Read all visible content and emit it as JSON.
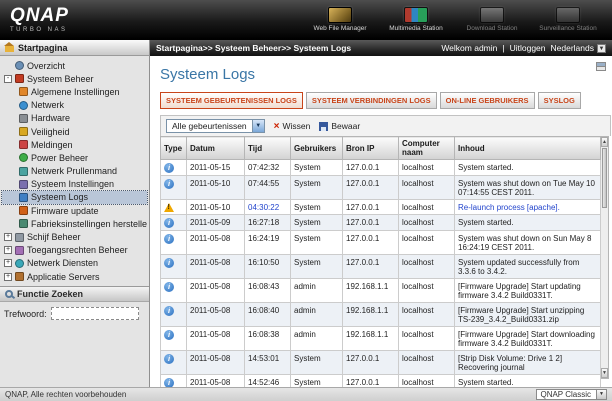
{
  "colors": {
    "accent_orange": "#c8451a",
    "title_blue": "#3a76a6",
    "link_blue": "#2244cc",
    "info_blue": "#2a6fc0",
    "warning_yellow": "#f0a800"
  },
  "header": {
    "logo_main": "QNAP",
    "logo_sub": "TURBO NAS",
    "apps": [
      {
        "label": "Web File Manager",
        "icon": "web-file-manager-icon",
        "dimmed": false
      },
      {
        "label": "Multimedia Station",
        "icon": "multimedia-station-icon",
        "dimmed": false
      },
      {
        "label": "Download Station",
        "icon": "download-station-icon",
        "dimmed": true
      },
      {
        "label": "Surveillance Station",
        "icon": "surveillance-station-icon",
        "dimmed": true
      }
    ]
  },
  "breadcrumb": {
    "path": "Startpagina>> Systeem Beheer>> Systeem Logs",
    "welcome": "Welkom admin",
    "separator": "|",
    "logout": "Uitloggen",
    "language": "Nederlands"
  },
  "sidebar": {
    "header": "Startpagina",
    "items": [
      {
        "label": "Overzicht",
        "level": 0,
        "expander": null,
        "icon": "overview-icon",
        "selected": false
      },
      {
        "label": "Systeem Beheer",
        "level": 0,
        "expander": "minus",
        "icon": "system-folder-icon",
        "selected": false
      },
      {
        "label": "Algemene Instellingen",
        "level": 1,
        "expander": null,
        "icon": "general-settings-icon",
        "selected": false
      },
      {
        "label": "Netwerk",
        "level": 1,
        "expander": null,
        "icon": "network-icon",
        "selected": false
      },
      {
        "label": "Hardware",
        "level": 1,
        "expander": null,
        "icon": "hardware-icon",
        "selected": false
      },
      {
        "label": "Veiligheid",
        "level": 1,
        "expander": null,
        "icon": "security-icon",
        "selected": false
      },
      {
        "label": "Meldingen",
        "level": 1,
        "expander": null,
        "icon": "notifications-icon",
        "selected": false
      },
      {
        "label": "Power Beheer",
        "level": 1,
        "expander": null,
        "icon": "power-icon",
        "selected": false
      },
      {
        "label": "Netwerk Prullenmand",
        "level": 1,
        "expander": null,
        "icon": "recycle-bin-icon",
        "selected": false
      },
      {
        "label": "Systeem Instellingen",
        "level": 1,
        "expander": null,
        "icon": "system-settings-icon",
        "selected": false
      },
      {
        "label": "Systeem Logs",
        "level": 1,
        "expander": null,
        "icon": "system-logs-icon",
        "selected": true
      },
      {
        "label": "Firmware update",
        "level": 1,
        "expander": null,
        "icon": "firmware-update-icon",
        "selected": false
      },
      {
        "label": "Fabrieksinstellingen herstellen",
        "level": 1,
        "expander": null,
        "icon": "restore-defaults-icon",
        "selected": false
      },
      {
        "label": "Schijf Beheer",
        "level": 0,
        "expander": "plus",
        "icon": "disk-manager-icon",
        "selected": false
      },
      {
        "label": "Toegangsrechten Beheer",
        "level": 0,
        "expander": "plus",
        "icon": "access-rights-icon",
        "selected": false
      },
      {
        "label": "Netwerk Diensten",
        "level": 0,
        "expander": "plus",
        "icon": "network-services-icon",
        "selected": false
      },
      {
        "label": "Applicatie Servers",
        "level": 0,
        "expander": "plus",
        "icon": "application-servers-icon",
        "selected": false
      }
    ],
    "search": {
      "header": "Functie Zoeken",
      "label": "Trefwoord:",
      "value": ""
    }
  },
  "main": {
    "title": "Systeem Logs",
    "tabs": [
      {
        "label": "SYSTEEM GEBEURTENISSEN LOGS",
        "active": true
      },
      {
        "label": "SYSTEEM VERBINDINGEN LOGS",
        "active": false
      },
      {
        "label": "ON-LINE GEBRUIKERS",
        "active": false
      },
      {
        "label": "SYSLOG",
        "active": false
      }
    ],
    "toolbar": {
      "filter_value": "Alle gebeurtenissen",
      "clear_label": "Wissen",
      "save_label": "Bewaar"
    },
    "table": {
      "columns": [
        "Type",
        "Datum",
        "Tijd",
        "Gebruikers",
        "Bron IP",
        "Computer naam",
        "Inhoud"
      ],
      "rows": [
        {
          "type": "info",
          "datum": "2011-05-15",
          "tijd": "07:42:32",
          "gebruikers": "System",
          "bron_ip": "127.0.0.1",
          "computer": "localhost",
          "inhoud": "System started.",
          "highlight": false
        },
        {
          "type": "info",
          "datum": "2011-05-10",
          "tijd": "07:44:55",
          "gebruikers": "System",
          "bron_ip": "127.0.0.1",
          "computer": "localhost",
          "inhoud": "System was shut down on Tue May 10 07:14:55 CEST 2011.",
          "highlight": false
        },
        {
          "type": "warning",
          "datum": "2011-05-10",
          "tijd": "04:30:22",
          "gebruikers": "System",
          "bron_ip": "127.0.0.1",
          "computer": "localhost",
          "inhoud": "Re-launch process [apache].",
          "highlight": true
        },
        {
          "type": "info",
          "datum": "2011-05-09",
          "tijd": "16:27:18",
          "gebruikers": "System",
          "bron_ip": "127.0.0.1",
          "computer": "localhost",
          "inhoud": "System started.",
          "highlight": false
        },
        {
          "type": "info",
          "datum": "2011-05-08",
          "tijd": "16:24:19",
          "gebruikers": "System",
          "bron_ip": "127.0.0.1",
          "computer": "localhost",
          "inhoud": "System was shut down on Sun May 8 16:24:19 CEST 2011.",
          "highlight": false
        },
        {
          "type": "info",
          "datum": "2011-05-08",
          "tijd": "16:10:50",
          "gebruikers": "System",
          "bron_ip": "127.0.0.1",
          "computer": "localhost",
          "inhoud": "System updated successfully from 3.3.6 to 3.4.2.",
          "highlight": false
        },
        {
          "type": "info",
          "datum": "2011-05-08",
          "tijd": "16:08:43",
          "gebruikers": "admin",
          "bron_ip": "192.168.1.1",
          "computer": "localhost",
          "inhoud": "[Firmware Upgrade] Start updating firmware 3.4.2 Build0331T.",
          "highlight": false
        },
        {
          "type": "info",
          "datum": "2011-05-08",
          "tijd": "16:08:40",
          "gebruikers": "admin",
          "bron_ip": "192.168.1.1",
          "computer": "localhost",
          "inhoud": "[Firmware Upgrade] Start unzipping TS-239_3.4.2_Build0331.zip",
          "highlight": false
        },
        {
          "type": "info",
          "datum": "2011-05-08",
          "tijd": "16:08:38",
          "gebruikers": "admin",
          "bron_ip": "192.168.1.1",
          "computer": "localhost",
          "inhoud": "[Firmware Upgrade] Start downloading firmware 3.4.2 Build0331T.",
          "highlight": false
        },
        {
          "type": "info",
          "datum": "2011-05-08",
          "tijd": "14:53:01",
          "gebruikers": "System",
          "bron_ip": "127.0.0.1",
          "computer": "localhost",
          "inhoud": "[Strip Disk Volume: Drive 1 2] Recovering journal",
          "highlight": false
        },
        {
          "type": "info",
          "datum": "2011-05-08",
          "tijd": "14:52:46",
          "gebruikers": "System",
          "bron_ip": "127.0.0.1",
          "computer": "localhost",
          "inhoud": "System started.",
          "highlight": false
        }
      ]
    }
  },
  "footer": {
    "copyright": "QNAP, Alle rechten voorbehouden",
    "theme": "QNAP Classic"
  }
}
